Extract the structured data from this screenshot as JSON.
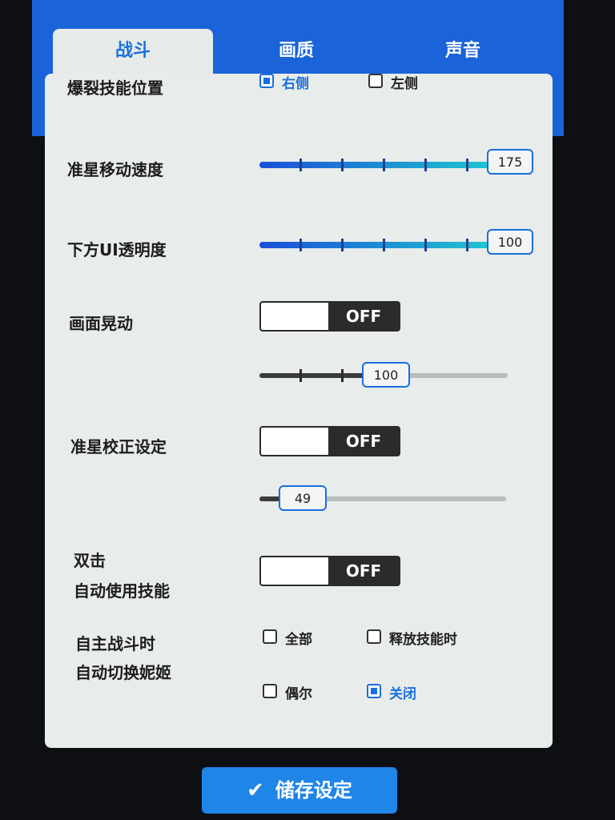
{
  "tabs": [
    {
      "label": "战斗",
      "active": true
    },
    {
      "label": "画质",
      "active": false
    },
    {
      "label": "声音",
      "active": false
    }
  ],
  "settings": {
    "burst_skill_position": {
      "label": "爆裂技能位置",
      "options": [
        {
          "label": "右侧",
          "checked": true
        },
        {
          "label": "左侧",
          "checked": false
        }
      ]
    },
    "crosshair_speed": {
      "label": "准星移动速度",
      "value": "175"
    },
    "lower_ui_opacity": {
      "label": "下方UI透明度",
      "value": "100"
    },
    "screen_shake": {
      "label": "画面晃动",
      "toggle": "OFF",
      "slider_value": "100"
    },
    "crosshair_correction": {
      "label": "准星校正设定",
      "toggle": "OFF",
      "slider_value": "49"
    },
    "double_tap": {
      "label_line1": "双击",
      "label_line2": "自动使用技能",
      "toggle": "OFF"
    },
    "auto_switch": {
      "label_line1": "自主战斗时",
      "label_line2": "自动切换妮姬",
      "options": [
        {
          "label": "全部",
          "checked": false
        },
        {
          "label": "释放技能时",
          "checked": false
        },
        {
          "label": "偶尔",
          "checked": false
        },
        {
          "label": "关闭",
          "checked": true
        }
      ]
    }
  },
  "save_button": {
    "label": "储存设定"
  },
  "colors": {
    "accent": "#1a6fe0",
    "header": "#1a63d8",
    "panel": "#e8ecea"
  }
}
